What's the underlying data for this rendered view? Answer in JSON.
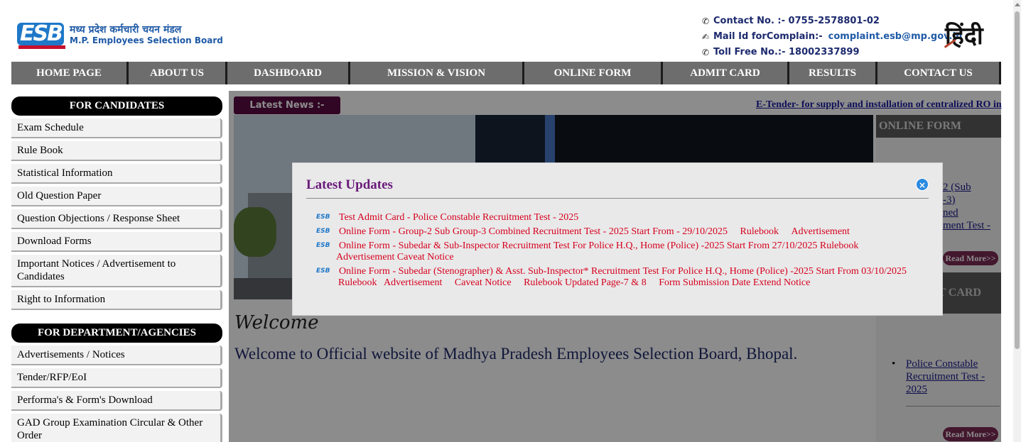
{
  "logo": {
    "mark": "ESB",
    "hindi_name": "मध्य प्रदेश कर्मचारी चयन मंडल",
    "english_name": "M.P. Employees Selection Board"
  },
  "contact": {
    "phone_label": "Contact No. :- 0755-2578801-02",
    "mail_label": "Mail Id forComplain:-",
    "mail": "complaint.esb@mp.gov.in",
    "tollfree": "Toll Free No.:- 18002337899",
    "hindi_toggle": "हिंदी"
  },
  "nav": [
    {
      "label": "HOME PAGE"
    },
    {
      "label": "ABOUT US"
    },
    {
      "label": "DASHBOARD"
    },
    {
      "label": "MISSION & VISION"
    },
    {
      "label": "ONLINE FORM"
    },
    {
      "label": "ADMIT CARD"
    },
    {
      "label": "RESULTS"
    },
    {
      "label": "CONTACT US"
    }
  ],
  "candidates": {
    "heading": "FOR CANDIDATES",
    "items": [
      {
        "label": "Exam Schedule"
      },
      {
        "label": "Rule Book"
      },
      {
        "label": "Statistical Information"
      },
      {
        "label": "Old Question Paper"
      },
      {
        "label": "Question Objections / Response Sheet"
      },
      {
        "label": "Download Forms"
      },
      {
        "label": "Important Notices / Advertisement to Candidates"
      },
      {
        "label": "Right to Information"
      }
    ]
  },
  "departments": {
    "heading": "FOR DEPARTMENT/AGENCIES",
    "items": [
      {
        "label": "Advertisements / Notices"
      },
      {
        "label": "Tender/RFP/EoI"
      },
      {
        "label": "Performa's & Form's Download"
      },
      {
        "label": "GAD Group Examination Circular & Other Order"
      }
    ]
  },
  "news": {
    "label": "Latest News :-",
    "ticker": "E-Tender- for supply and installation of centralized RO in"
  },
  "welcome": {
    "script": "Welcome",
    "text": "Welcome to Official website of Madhya Pradesh Employees Selection Board, Bhopal."
  },
  "right_panel": {
    "online_form_heading": "ONLINE FORM",
    "frag1": "2 (Sub",
    "frag2": "-3)",
    "frag3": "ned",
    "frag4": "ment Test -",
    "read_more": "Read More>>",
    "admit_heading": "T CARD",
    "list_item": "Police Constable Recruitment Test - 2025",
    "read_more2": "Read More>>"
  },
  "popup": {
    "title": "Latest Updates",
    "close": "×",
    "updates": [
      {
        "text": "Test Admit Card - Police Constable Recruitment Test - 2025"
      },
      {
        "text": "Online Form - Group-2 Sub Group-3 Combined Recruitment Test - 2025 Start From - 29/10/2025",
        "links": [
          "Rulebook",
          "Advertisement"
        ]
      },
      {
        "text": "Online Form - Subedar & Sub-Inspector  Recruitment Test For Police H.Q., Home (Police) -2025 Start From 27/10/2025",
        "links": [
          "Rulebook",
          "Advertisement",
          "Caveat Notice"
        ]
      },
      {
        "text": "Online Form - Subedar (Stenographer) & Asst. Sub-Inspector* Recruitment Test For Police H.Q., Home (Police) -2025 Start From 03/10/2025",
        "links": [
          "Rulebook",
          "Advertisement",
          "Caveat Notice",
          "Rulebook Updated Page-7 & 8",
          "Form Submission Date Extend Notice"
        ]
      }
    ]
  },
  "colors": {
    "nav_bg": "#6d6d6d",
    "news_label_bg": "#5a0a43",
    "popup_title": "#6a1b7a",
    "update_link": "#d6001c",
    "brand_blue": "#1f78c8"
  }
}
